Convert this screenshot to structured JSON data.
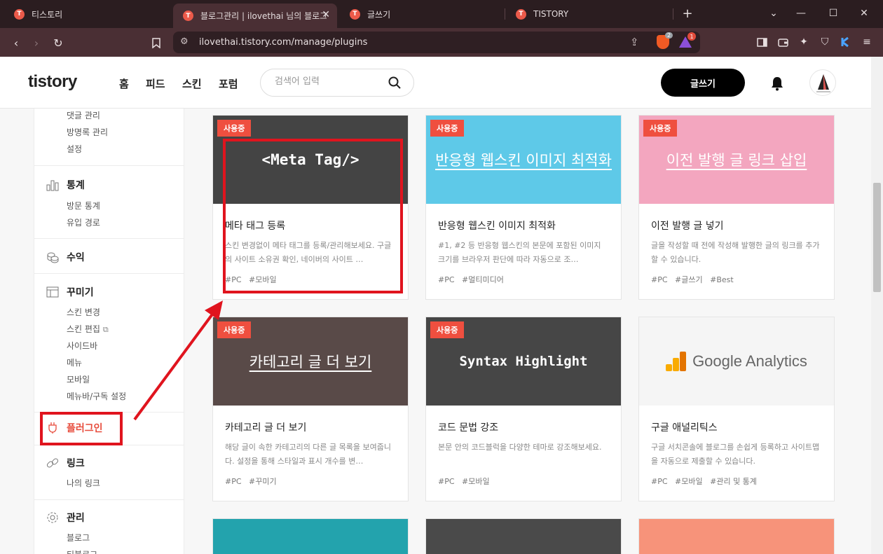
{
  "browser": {
    "tabs": [
      {
        "label": "티스토리",
        "active": false
      },
      {
        "label": "블로그관리 | ilovethai 님의 블로그",
        "active": true
      },
      {
        "label": "글쓰기",
        "active": false
      },
      {
        "label": "TISTORY",
        "active": false
      }
    ],
    "favicon_letter": "T",
    "url": "ilovethai.tistory.com/manage/plugins",
    "shield_count": "2",
    "rewards_count": "1"
  },
  "header": {
    "logo": "tistory",
    "nav": [
      "홈",
      "피드",
      "스킨",
      "포럼"
    ],
    "search_placeholder": "검색어 입력",
    "write_button": "글쓰기"
  },
  "sidebar": {
    "top_items": [
      "댓글 관리",
      "방명록 관리",
      "설정"
    ],
    "stats": {
      "label": "통계",
      "items": [
        "방문 통계",
        "유입 경로"
      ]
    },
    "revenue": {
      "label": "수익"
    },
    "decorate": {
      "label": "꾸미기",
      "items": [
        "스킨 변경",
        "스킨 편집",
        "사이드바",
        "메뉴",
        "모바일",
        "메뉴바/구독 설정"
      ]
    },
    "plugin": {
      "label": "플러그인"
    },
    "link": {
      "label": "링크",
      "items": [
        "나의 링크"
      ]
    },
    "manage": {
      "label": "관리",
      "items": [
        "블로그",
        "티블로그"
      ]
    }
  },
  "plugins": [
    {
      "badge": "사용중",
      "thumb_text": "<Meta Tag/>",
      "title": "메타 태그 등록",
      "desc": "스킨 변경없이 메타 태그를 등록/관리해보세요. 구글의 사이트 소유권 확인, 네이버의 사이트 …",
      "tags": [
        "#PC",
        "#모바일"
      ]
    },
    {
      "badge": "사용중",
      "thumb_text": "반응형 웹스킨 이미지 최적화",
      "title": "반응형 웹스킨 이미지 최적화",
      "desc": "#1, #2 등 반응형 웹스킨의 본문에 포함된 이미지 크기를 브라우저 판단에 따라 자동으로 조…",
      "tags": [
        "#PC",
        "#멀티미디어"
      ]
    },
    {
      "badge": "사용중",
      "thumb_text": "이전 발행 글 링크 삽입",
      "title": "이전 발행 글 넣기",
      "desc": "글을 작성할 때 전에 작성해 발행한 글의 링크를 추가할 수 있습니다.",
      "tags": [
        "#PC",
        "#글쓰기",
        "#Best"
      ]
    },
    {
      "badge": "사용중",
      "thumb_text": "카테고리 글 더 보기",
      "title": "카테고리 글 더 보기",
      "desc": "해당 글이 속한 카테고리의 다른 글 목록을 보여줍니다. 설정을 통해 스타일과 표시 개수를 변…",
      "tags": [
        "#PC",
        "#꾸미기"
      ]
    },
    {
      "badge": "사용중",
      "thumb_text": "Syntax Highlight",
      "title": "코드 문법 강조",
      "desc": "본문 안의 코드블럭을 다양한 테마로 강조해보세요.",
      "tags": [
        "#PC",
        "#모바일"
      ]
    },
    {
      "badge": "",
      "thumb_text": "Google Analytics",
      "title": "구글 애널리틱스",
      "desc": "구글 서치콘솔에 블로그를 손쉽게 등록하고 사이트맵을 자동으로 제출할 수 있습니다.",
      "tags": [
        "#PC",
        "#모바일",
        "#관리 및 통계"
      ]
    }
  ],
  "colors": {
    "accent_red": "#ef4f3f",
    "annotation_red": "#e0141e",
    "tab_bg": "#2b1d20",
    "toolbar_bg": "#4a2f34"
  }
}
